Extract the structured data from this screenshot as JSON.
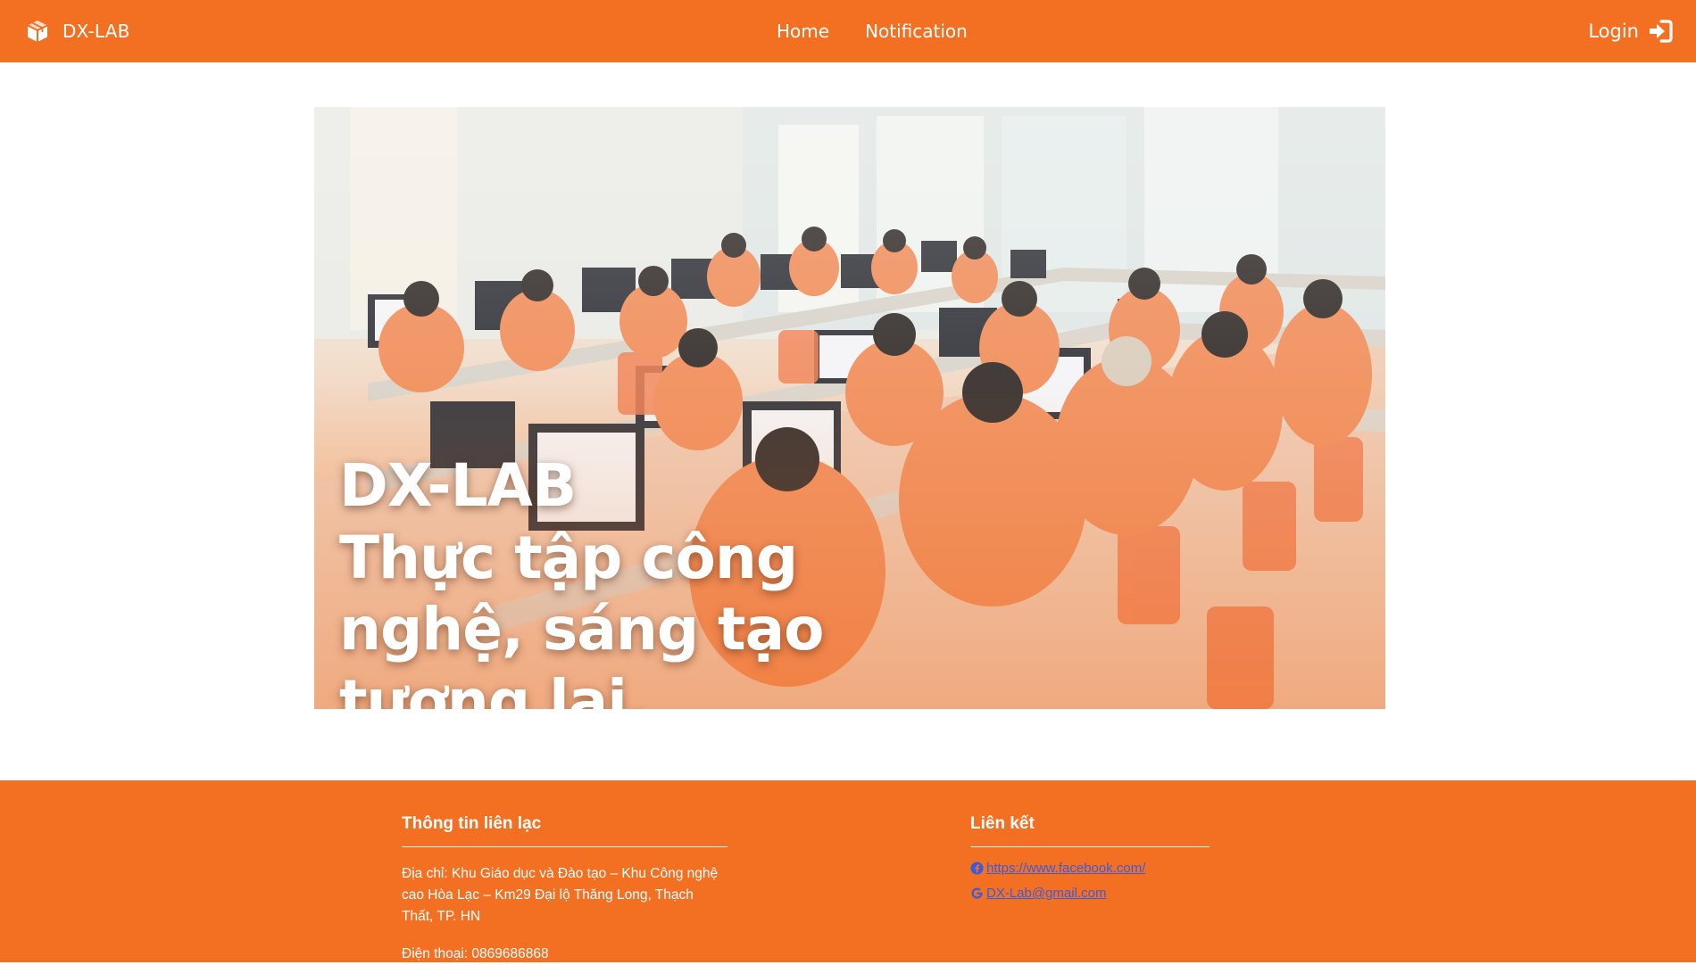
{
  "navbar": {
    "brand": "DX-LAB",
    "brand_icon": "cube-icon",
    "links": [
      "Home",
      "Notification"
    ],
    "login_label": "Login",
    "login_icon": "sign-in-icon",
    "background": "#f37023"
  },
  "hero": {
    "title": "DX-LAB",
    "tagline": "Thực tập công nghệ, sáng tạo tương lai."
  },
  "footer": {
    "contact": {
      "heading": "Thông tin liên lạc",
      "address": "Địa chỉ: Khu Giáo dục và Đào tạo – Khu Công nghệ cao Hòa Lạc – Km29 Đại lộ Thăng Long, Thạch Thất, TP. HN",
      "phone": "Điện thoại: 0869686868"
    },
    "links": {
      "heading": "Liên kết",
      "facebook": "https://www.facebook.com/",
      "facebook_icon": "facebook-icon",
      "email": "DX-Lab@gmail.com",
      "email_icon": "google-icon",
      "link_color": "#3b5bdb"
    }
  }
}
